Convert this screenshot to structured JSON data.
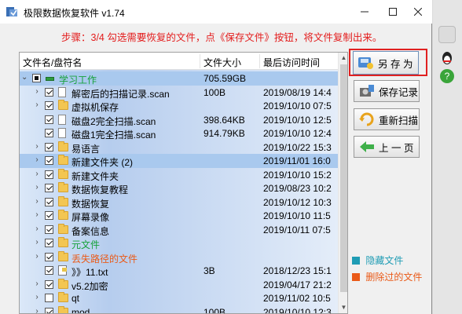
{
  "window": {
    "title": "极限数据恢复软件 v1.74"
  },
  "instruction": "步骤：3/4 勾选需要恢复的文件，点《保存文件》按钮，将文件复制出来。",
  "columns": {
    "name": "文件名/盘符名",
    "size": "文件大小",
    "date": "最后访问时间"
  },
  "rows": [
    {
      "name": "学习工作",
      "size": "705.59GB",
      "date": "",
      "icon": "drive",
      "style": "green",
      "twisty": "v",
      "check": "partial",
      "indent": 0,
      "sel": true
    },
    {
      "name": "解密后的扫描记录.scan",
      "size": "100B",
      "date": "2019/08/19 14:4",
      "icon": "file",
      "style": "",
      "twisty": ">",
      "check": "checked",
      "indent": 1,
      "sel": false
    },
    {
      "name": "虚拟机保存",
      "size": "",
      "date": "2019/10/10 07:5",
      "icon": "folder",
      "style": "",
      "twisty": ">",
      "check": "checked",
      "indent": 1,
      "sel": false
    },
    {
      "name": "磁盘2完全扫描.scan",
      "size": "398.64KB",
      "date": "2019/10/10 12:5",
      "icon": "file",
      "style": "",
      "twisty": "",
      "check": "checked",
      "indent": 1,
      "sel": false
    },
    {
      "name": "磁盘1完全扫描.scan",
      "size": "914.79KB",
      "date": "2019/10/10 12:4",
      "icon": "file",
      "style": "",
      "twisty": "",
      "check": "checked",
      "indent": 1,
      "sel": false
    },
    {
      "name": "易语言",
      "size": "",
      "date": "2019/10/22 15:3",
      "icon": "folder",
      "style": "",
      "twisty": ">",
      "check": "checked",
      "indent": 1,
      "sel": false
    },
    {
      "name": "新建文件夹 (2)",
      "size": "",
      "date": "2019/11/01 16:0",
      "icon": "folder",
      "style": "",
      "twisty": ">",
      "check": "checked",
      "indent": 1,
      "sel": true
    },
    {
      "name": "新建文件夹",
      "size": "",
      "date": "2019/10/10 15:2",
      "icon": "folder",
      "style": "",
      "twisty": ">",
      "check": "checked",
      "indent": 1,
      "sel": false
    },
    {
      "name": "数据恢复教程",
      "size": "",
      "date": "2019/08/23 10:2",
      "icon": "folder",
      "style": "",
      "twisty": ">",
      "check": "checked",
      "indent": 1,
      "sel": false
    },
    {
      "name": "数据恢复",
      "size": "",
      "date": "2019/10/12 10:3",
      "icon": "folder",
      "style": "",
      "twisty": ">",
      "check": "checked",
      "indent": 1,
      "sel": false
    },
    {
      "name": "屏幕录像",
      "size": "",
      "date": "2019/10/10 11:5",
      "icon": "folder",
      "style": "",
      "twisty": ">",
      "check": "checked",
      "indent": 1,
      "sel": false
    },
    {
      "name": "备案信息",
      "size": "",
      "date": "2019/10/11 07:5",
      "icon": "folder",
      "style": "",
      "twisty": ">",
      "check": "checked",
      "indent": 1,
      "sel": false
    },
    {
      "name": "元文件",
      "size": "",
      "date": "",
      "icon": "folder",
      "style": "green",
      "twisty": ">",
      "check": "checked",
      "indent": 1,
      "sel": false
    },
    {
      "name": "丢失路径的文件",
      "size": "",
      "date": "",
      "icon": "folder",
      "style": "orange",
      "twisty": ">",
      "check": "checked",
      "indent": 1,
      "sel": false
    },
    {
      "name": "》》11.txt",
      "size": "3B",
      "date": "2018/12/23 15:1",
      "icon": "txt",
      "style": "",
      "twisty": "",
      "check": "checked",
      "indent": 1,
      "sel": false
    },
    {
      "name": "v5.2加密",
      "size": "",
      "date": "2019/04/17 21:2",
      "icon": "folder",
      "style": "",
      "twisty": ">",
      "check": "checked",
      "indent": 1,
      "sel": false
    },
    {
      "name": "qt",
      "size": "",
      "date": "2019/11/02 10:5",
      "icon": "folder",
      "style": "",
      "twisty": ">",
      "check": "unchecked",
      "indent": 1,
      "sel": false
    },
    {
      "name": "mod",
      "size": "100B",
      "date": "2019/10/10 12:3",
      "icon": "folder",
      "style": "",
      "twisty": ">",
      "check": "checked",
      "indent": 1,
      "sel": false
    }
  ],
  "buttons": {
    "save_file": "另 存 为",
    "save_record": "保存记录",
    "rescan": "重新扫描",
    "back": "上 一 页"
  },
  "legend": {
    "hidden": "隐藏文件",
    "deleted": "删除过的文件",
    "hidden_color": "#1f9cb4",
    "deleted_color": "#ea5a18"
  },
  "colors": {
    "accent_red": "#e31b1b",
    "selection": "#a9c9ee"
  }
}
